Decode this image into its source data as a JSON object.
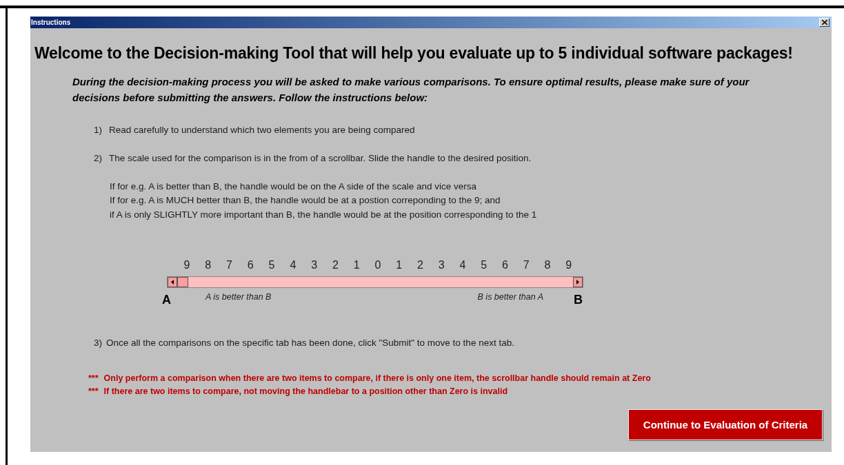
{
  "window": {
    "title": "Instructions"
  },
  "heading": "Welcome to the Decision-making Tool that will help you evaluate up to 5 individual software packages!",
  "intro": "During the decision-making process you  will be asked to make various comparisons.  To ensure optimal results, please  make sure of your decisions before submitting the answers.  Follow the instructions below:",
  "steps": [
    {
      "number": "1)",
      "text": "Read carefully to understand which two elements you are being compared"
    },
    {
      "number": "2)",
      "text": "The scale used for the comparison is in the from of a scrollbar.  Slide the handle to the desired position.",
      "notes": [
        "If for e.g. A is better than B, the handle would be on the A side of the scale and vice versa",
        "If for e.g. A is MUCH better than B, the handle would be at a postion correponding to the 9; and",
        "if A is only SLIGHTLY more important than B, the handle would be at the position corresponding to the 1"
      ]
    }
  ],
  "scale": {
    "ticks": [
      "9",
      "8",
      "7",
      "6",
      "5",
      "4",
      "3",
      "2",
      "1",
      "0",
      "1",
      "2",
      "3",
      "4",
      "5",
      "6",
      "7",
      "8",
      "9"
    ],
    "left_end": "A",
    "right_end": "B",
    "left_caption": "A is better than B",
    "right_caption": "B is better than A"
  },
  "final_step": {
    "number": "3)",
    "text": "Once all the comparisons on the specific tab has been done, click \"Submit\" to move to the next tab."
  },
  "warnings": [
    {
      "marker": "***",
      "text": "Only perform a comparison when there are two items to compare, if there is only one item, the scrollbar handle should remain at Zero"
    },
    {
      "marker": "***",
      "text": "If there are two items to compare, not moving the handlebar to a position other than Zero is invalid"
    }
  ],
  "button": "Continue to Evaluation of Criteria"
}
